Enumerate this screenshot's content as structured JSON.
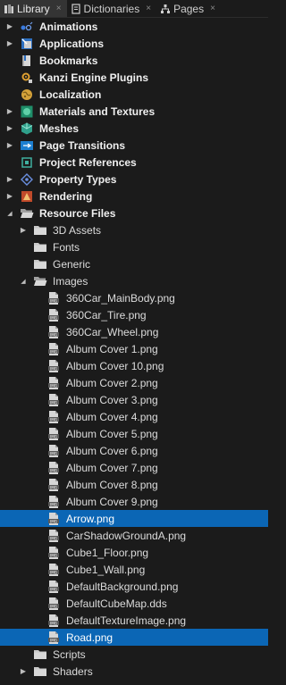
{
  "tabs": [
    {
      "label": "Library",
      "close": "×",
      "active": true
    },
    {
      "label": "Dictionaries",
      "close": "×",
      "active": false
    },
    {
      "label": "Pages",
      "close": "×",
      "active": false
    }
  ],
  "tree": [
    {
      "label": "Animations",
      "level": 0,
      "expander": "collapsed",
      "icon": "animations-icon",
      "bold": true
    },
    {
      "label": "Applications",
      "level": 0,
      "expander": "collapsed",
      "icon": "applications-icon",
      "bold": true
    },
    {
      "label": "Bookmarks",
      "level": 0,
      "expander": "none",
      "icon": "bookmarks-icon",
      "bold": true
    },
    {
      "label": "Kanzi Engine Plugins",
      "level": 0,
      "expander": "none",
      "icon": "plugins-icon",
      "bold": true
    },
    {
      "label": "Localization",
      "level": 0,
      "expander": "none",
      "icon": "localization-icon",
      "bold": true
    },
    {
      "label": "Materials and Textures",
      "level": 0,
      "expander": "collapsed",
      "icon": "materials-icon",
      "bold": true
    },
    {
      "label": "Meshes",
      "level": 0,
      "expander": "collapsed",
      "icon": "meshes-icon",
      "bold": true
    },
    {
      "label": "Page Transitions",
      "level": 0,
      "expander": "collapsed",
      "icon": "page-transitions-icon",
      "bold": true
    },
    {
      "label": "Project References",
      "level": 0,
      "expander": "none",
      "icon": "project-references-icon",
      "bold": true
    },
    {
      "label": "Property Types",
      "level": 0,
      "expander": "collapsed",
      "icon": "property-types-icon",
      "bold": true
    },
    {
      "label": "Rendering",
      "level": 0,
      "expander": "collapsed",
      "icon": "rendering-icon",
      "bold": true
    },
    {
      "label": "Resource Files",
      "level": 0,
      "expander": "expanded",
      "icon": "open-folder-icon",
      "bold": true
    },
    {
      "label": "3D Assets",
      "level": 1,
      "expander": "collapsed",
      "icon": "folder-icon",
      "bold": false
    },
    {
      "label": "Fonts",
      "level": 1,
      "expander": "none",
      "icon": "folder-icon",
      "bold": false
    },
    {
      "label": "Generic",
      "level": 1,
      "expander": "none",
      "icon": "folder-icon",
      "bold": false
    },
    {
      "label": "Images",
      "level": 1,
      "expander": "expanded",
      "icon": "open-folder-icon",
      "bold": false
    },
    {
      "label": "360Car_MainBody.png",
      "level": 2,
      "expander": "none",
      "icon": "image-file-icon",
      "bold": false
    },
    {
      "label": "360Car_Tire.png",
      "level": 2,
      "expander": "none",
      "icon": "image-file-icon",
      "bold": false
    },
    {
      "label": "360Car_Wheel.png",
      "level": 2,
      "expander": "none",
      "icon": "image-file-icon",
      "bold": false
    },
    {
      "label": "Album Cover 1.png",
      "level": 2,
      "expander": "none",
      "icon": "image-file-icon",
      "bold": false
    },
    {
      "label": "Album Cover 10.png",
      "level": 2,
      "expander": "none",
      "icon": "image-file-icon",
      "bold": false
    },
    {
      "label": "Album Cover 2.png",
      "level": 2,
      "expander": "none",
      "icon": "image-file-icon",
      "bold": false
    },
    {
      "label": "Album Cover 3.png",
      "level": 2,
      "expander": "none",
      "icon": "image-file-icon",
      "bold": false
    },
    {
      "label": "Album Cover 4.png",
      "level": 2,
      "expander": "none",
      "icon": "image-file-icon",
      "bold": false
    },
    {
      "label": "Album Cover 5.png",
      "level": 2,
      "expander": "none",
      "icon": "image-file-icon",
      "bold": false
    },
    {
      "label": "Album Cover 6.png",
      "level": 2,
      "expander": "none",
      "icon": "image-file-icon",
      "bold": false
    },
    {
      "label": "Album Cover 7.png",
      "level": 2,
      "expander": "none",
      "icon": "image-file-icon",
      "bold": false
    },
    {
      "label": "Album Cover 8.png",
      "level": 2,
      "expander": "none",
      "icon": "image-file-icon",
      "bold": false
    },
    {
      "label": "Album Cover 9.png",
      "level": 2,
      "expander": "none",
      "icon": "image-file-icon",
      "bold": false
    },
    {
      "label": "Arrow.png",
      "level": 2,
      "expander": "none",
      "icon": "image-file-icon",
      "bold": false,
      "selected": true
    },
    {
      "label": "CarShadowGroundA.png",
      "level": 2,
      "expander": "none",
      "icon": "image-file-icon",
      "bold": false
    },
    {
      "label": "Cube1_Floor.png",
      "level": 2,
      "expander": "none",
      "icon": "image-file-icon",
      "bold": false
    },
    {
      "label": "Cube1_Wall.png",
      "level": 2,
      "expander": "none",
      "icon": "image-file-icon",
      "bold": false
    },
    {
      "label": "DefaultBackground.png",
      "level": 2,
      "expander": "none",
      "icon": "image-file-icon",
      "bold": false
    },
    {
      "label": "DefaultCubeMap.dds",
      "level": 2,
      "expander": "none",
      "icon": "image-file-icon",
      "bold": false
    },
    {
      "label": "DefaultTextureImage.png",
      "level": 2,
      "expander": "none",
      "icon": "image-file-icon",
      "bold": false
    },
    {
      "label": "Road.png",
      "level": 2,
      "expander": "none",
      "icon": "image-file-icon",
      "bold": false,
      "selected": true
    },
    {
      "label": "Scripts",
      "level": 1,
      "expander": "none",
      "icon": "folder-icon",
      "bold": false
    },
    {
      "label": "Shaders",
      "level": 1,
      "expander": "collapsed",
      "icon": "folder-icon",
      "bold": false
    }
  ],
  "colors": {
    "background": "#1b1b1b",
    "active_tab": "#343434",
    "selection": "#0b66b5",
    "folder": "#c9c9c9"
  }
}
